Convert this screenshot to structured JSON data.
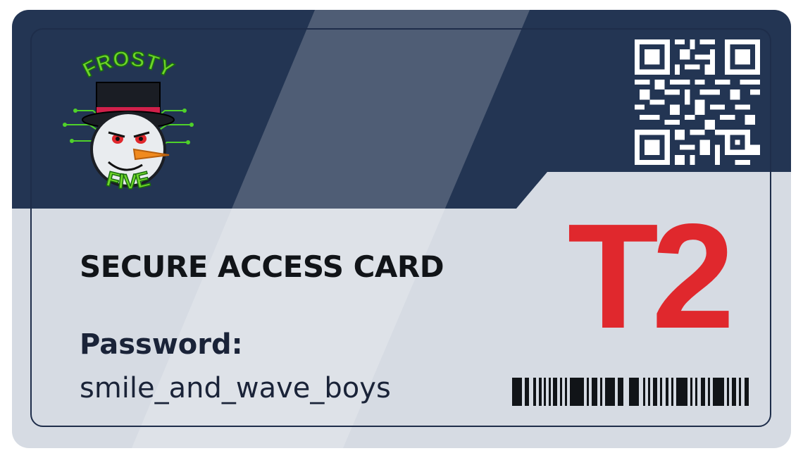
{
  "card": {
    "title": "SECURE ACCESS CARD",
    "password_label": "Password:",
    "password_value": "smile_and_wave_boys",
    "tier_code": "T2"
  },
  "logo": {
    "top_text": "FROSTY",
    "bottom_text": "FIVE"
  },
  "icons": [
    "frosty-five-logo-icon",
    "snowman-icon",
    "qr-code-icon",
    "barcode-icon"
  ],
  "colors": {
    "navy": "#233553",
    "card_gray": "#d6dbe3",
    "tier_red": "#e0282d",
    "logo_green": "#6fd62a",
    "text_dark": "#111418"
  }
}
